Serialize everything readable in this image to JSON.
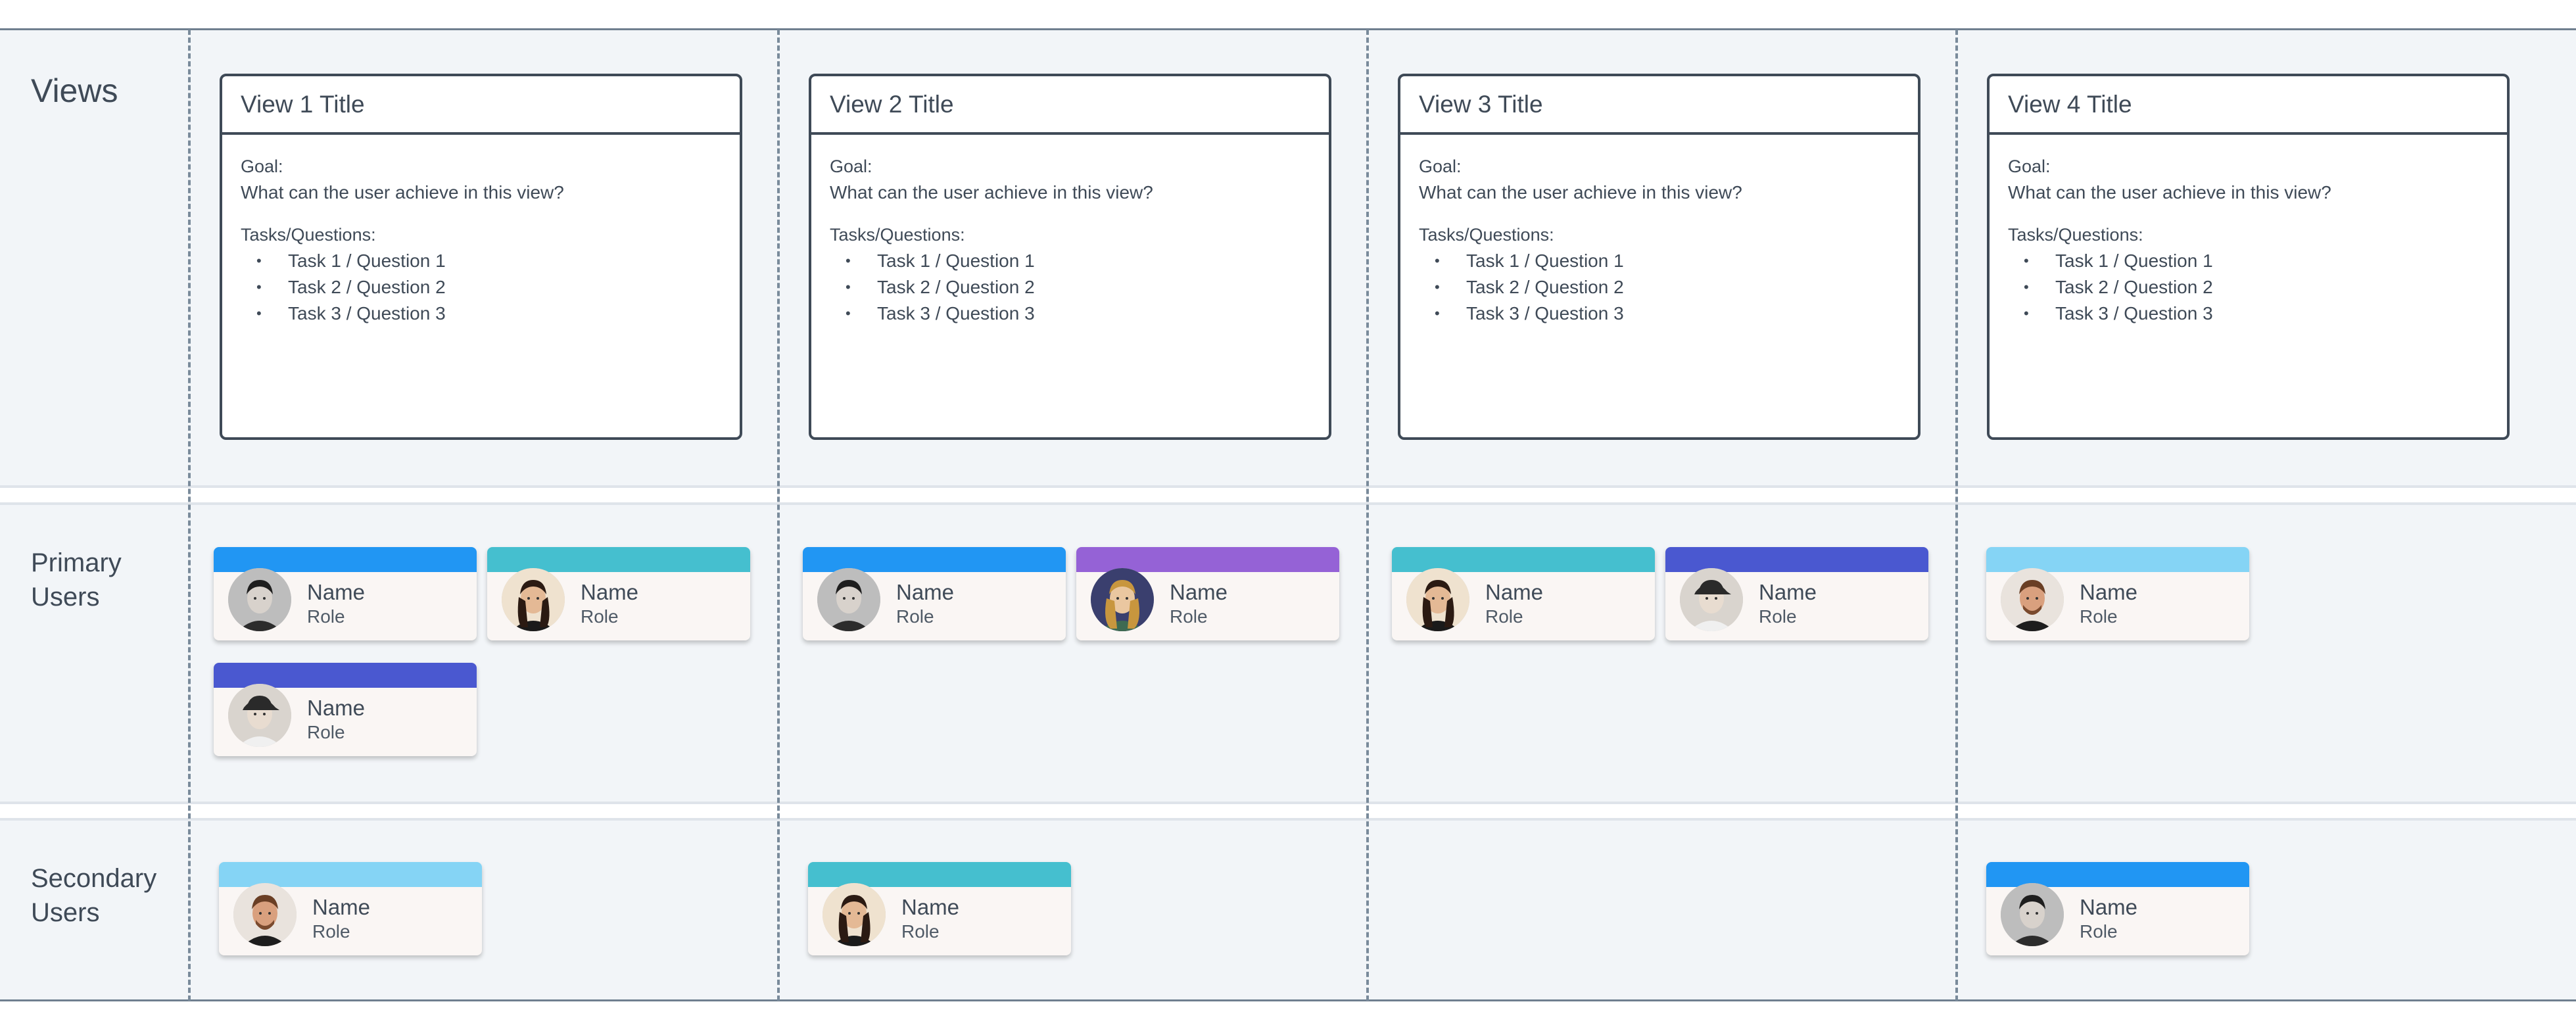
{
  "rows": {
    "views_label": "Views",
    "primary_label": "Primary\nUsers",
    "secondary_label": "Secondary\nUsers"
  },
  "views": [
    {
      "title": "View 1 Title",
      "goal_label": "Goal:",
      "goal_text": "What can the user achieve in this view?",
      "tasks_label": "Tasks/Questions:",
      "tasks": [
        "Task 1 / Question 1",
        "Task 2 / Question 2",
        "Task 3 / Question 3"
      ]
    },
    {
      "title": "View 2 Title",
      "goal_label": "Goal:",
      "goal_text": "What can the user achieve in this view?",
      "tasks_label": "Tasks/Questions:",
      "tasks": [
        "Task 1 / Question 1",
        "Task 2 / Question 2",
        "Task 3 / Question 3"
      ]
    },
    {
      "title": "View 3 Title",
      "goal_label": "Goal:",
      "goal_text": "What can the user achieve in this view?",
      "tasks_label": "Tasks/Questions:",
      "tasks": [
        "Task 1 / Question 1",
        "Task 2 / Question 2",
        "Task 3 / Question 3"
      ]
    },
    {
      "title": "View 4 Title",
      "goal_label": "Goal:",
      "goal_text": "What can the user achieve in this view?",
      "tasks_label": "Tasks/Questions:",
      "tasks": [
        "Task 1 / Question 1",
        "Task 2 / Question 2",
        "Task 3 / Question 3"
      ]
    }
  ],
  "user_cards": {
    "primary": [
      {
        "name": "Name",
        "role": "Role",
        "color": "#2196f3",
        "avatar": "man-dark-hair-photo"
      },
      {
        "name": "Name",
        "role": "Role",
        "color": "#45bfcf",
        "avatar": "woman-dark-hair-photo"
      },
      {
        "name": "Name",
        "role": "Role",
        "color": "#4a58d0",
        "avatar": "woman-cap-photo"
      },
      {
        "name": "Name",
        "role": "Role",
        "color": "#2196f3",
        "avatar": "man-dark-hair-photo"
      },
      {
        "name": "Name",
        "role": "Role",
        "color": "#9562d6",
        "avatar": "woman-blonde-photo"
      },
      {
        "name": "Name",
        "role": "Role",
        "color": "#45bfcf",
        "avatar": "woman-dark-hair-photo"
      },
      {
        "name": "Name",
        "role": "Role",
        "color": "#4a58d0",
        "avatar": "woman-cap-photo"
      },
      {
        "name": "Name",
        "role": "Role",
        "color": "#85d4f5",
        "avatar": "man-beard-photo"
      }
    ],
    "secondary": [
      {
        "name": "Name",
        "role": "Role",
        "color": "#85d4f5",
        "avatar": "man-beard-photo"
      },
      {
        "name": "Name",
        "role": "Role",
        "color": "#45bfcf",
        "avatar": "woman-dark-hair-photo"
      },
      {
        "name": "Name",
        "role": "Role",
        "color": "#2196f3",
        "avatar": "man-dark-hair-photo"
      }
    ]
  }
}
